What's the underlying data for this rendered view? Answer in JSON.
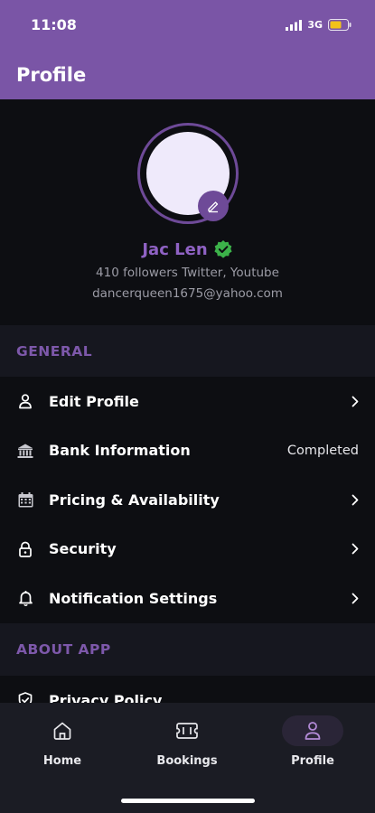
{
  "status_bar": {
    "time": "11:08",
    "network": "3G"
  },
  "header": {
    "title": "Profile"
  },
  "profile": {
    "name": "Jac Len",
    "followers": "410 followers Twitter, Youtube",
    "email": "dancerqueen1675@yahoo.com"
  },
  "sections": {
    "general": "GENERAL",
    "about": "ABOUT APP"
  },
  "menu_general": [
    {
      "label": "Edit Profile",
      "icon": "user-icon"
    },
    {
      "label": "Bank Information",
      "icon": "bank-icon",
      "value": "Completed"
    },
    {
      "label": "Pricing & Availability",
      "icon": "calendar-icon"
    },
    {
      "label": "Security",
      "icon": "lock-icon"
    },
    {
      "label": "Notification Settings",
      "icon": "bell-icon"
    }
  ],
  "menu_about": [
    {
      "label": "Privacy Policy",
      "icon": "shield-icon"
    }
  ],
  "nav": [
    {
      "label": "Home",
      "icon": "home-icon"
    },
    {
      "label": "Bookings",
      "icon": "ticket-icon"
    },
    {
      "label": "Profile",
      "icon": "profile-icon",
      "active": true
    }
  ],
  "colors": {
    "accent": "#7a55a6",
    "name": "#8f62c4",
    "verified": "#3cb24a",
    "background": "#0d0e12",
    "section_bg": "#16171f"
  }
}
